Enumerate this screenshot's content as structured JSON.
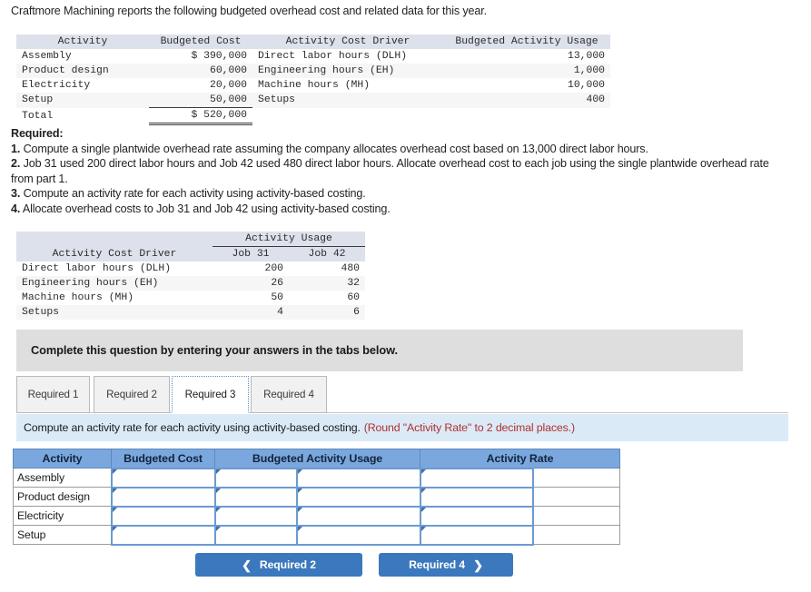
{
  "intro": "Craftmore Machining reports the following budgeted overhead cost and related data for this year.",
  "overhead_table": {
    "headers": [
      "Activity",
      "Budgeted Cost",
      "Activity Cost Driver",
      "Budgeted Activity Usage"
    ],
    "rows": [
      {
        "activity": "Assembly",
        "cost": "$ 390,000",
        "driver": "Direct labor hours (DLH)",
        "usage": "13,000"
      },
      {
        "activity": "Product design",
        "cost": "60,000",
        "driver": "Engineering hours (EH)",
        "usage": "1,000"
      },
      {
        "activity": "Electricity",
        "cost": "20,000",
        "driver": "Machine hours (MH)",
        "usage": "10,000"
      },
      {
        "activity": "Setup",
        "cost": "50,000",
        "driver": "Setups",
        "usage": "400"
      }
    ],
    "total_label": "Total",
    "total_cost": "$ 520,000"
  },
  "required": {
    "heading": "Required:",
    "item1_num": "1.",
    "item1_text": "Compute a single plantwide overhead rate assuming the company allocates overhead cost based on 13,000 direct labor hours.",
    "item2_num": "2.",
    "item2_text": "Job 31 used 200 direct labor hours and Job 42 used 480 direct labor hours. Allocate overhead cost to each job using the single plantwide overhead rate from part 1.",
    "item3_num": "3.",
    "item3_text": "Compute an activity rate for each activity using activity-based costing.",
    "item4_num": "4.",
    "item4_text": "Allocate overhead costs to Job 31 and Job 42 using activity-based costing."
  },
  "usage_table": {
    "span_header": "Activity Usage",
    "headers": [
      "Activity Cost Driver",
      "Job 31",
      "Job 42"
    ],
    "rows": [
      {
        "driver": "Direct labor hours (DLH)",
        "job31": "200",
        "job42": "480"
      },
      {
        "driver": "Engineering hours (EH)",
        "job31": "26",
        "job42": "32"
      },
      {
        "driver": "Machine hours (MH)",
        "job31": "50",
        "job42": "60"
      },
      {
        "driver": "Setups",
        "job31": "4",
        "job42": "6"
      }
    ]
  },
  "banner": {
    "text": "Complete this question by entering your answers in the tabs below."
  },
  "tabs": [
    {
      "id": "required-1",
      "label": "Required 1",
      "active": false
    },
    {
      "id": "required-2",
      "label": "Required 2",
      "active": false
    },
    {
      "id": "required-3",
      "label": "Required 3",
      "active": true
    },
    {
      "id": "required-4",
      "label": "Required 4",
      "active": false
    }
  ],
  "instruction": {
    "main": "Compute an activity rate for each activity using activity-based costing.",
    "round_note": "(Round \"Activity Rate\" to 2 decimal places.)"
  },
  "answer_grid": {
    "headers": [
      "Activity",
      "Budgeted Cost",
      "Budgeted Activity Usage",
      "Activity Rate"
    ],
    "rows": [
      {
        "activity": "Assembly",
        "budgeted_cost": "",
        "usage_left": "",
        "usage_right": "",
        "rate_left": "",
        "rate_right": ""
      },
      {
        "activity": "Product design",
        "budgeted_cost": "",
        "usage_left": "",
        "usage_right": "",
        "rate_left": "",
        "rate_right": ""
      },
      {
        "activity": "Electricity",
        "budgeted_cost": "",
        "usage_left": "",
        "usage_right": "",
        "rate_left": "",
        "rate_right": ""
      },
      {
        "activity": "Setup",
        "budgeted_cost": "",
        "usage_left": "",
        "usage_right": "",
        "rate_left": "",
        "rate_right": ""
      }
    ]
  },
  "nav": {
    "prev_label": "Required 2",
    "prev_icon": "chevron-left-icon",
    "next_label": "Required 4",
    "next_icon": "chevron-right-icon"
  },
  "colors": {
    "header_blue": "#7aa8de",
    "button_blue": "#3b78bd",
    "instruction_bg": "#dbeaf7",
    "banner_gray": "#dedede",
    "table_header_gray": "#dde1eb",
    "round_note_red": "#b03030",
    "input_border": "#6b9bd2"
  }
}
